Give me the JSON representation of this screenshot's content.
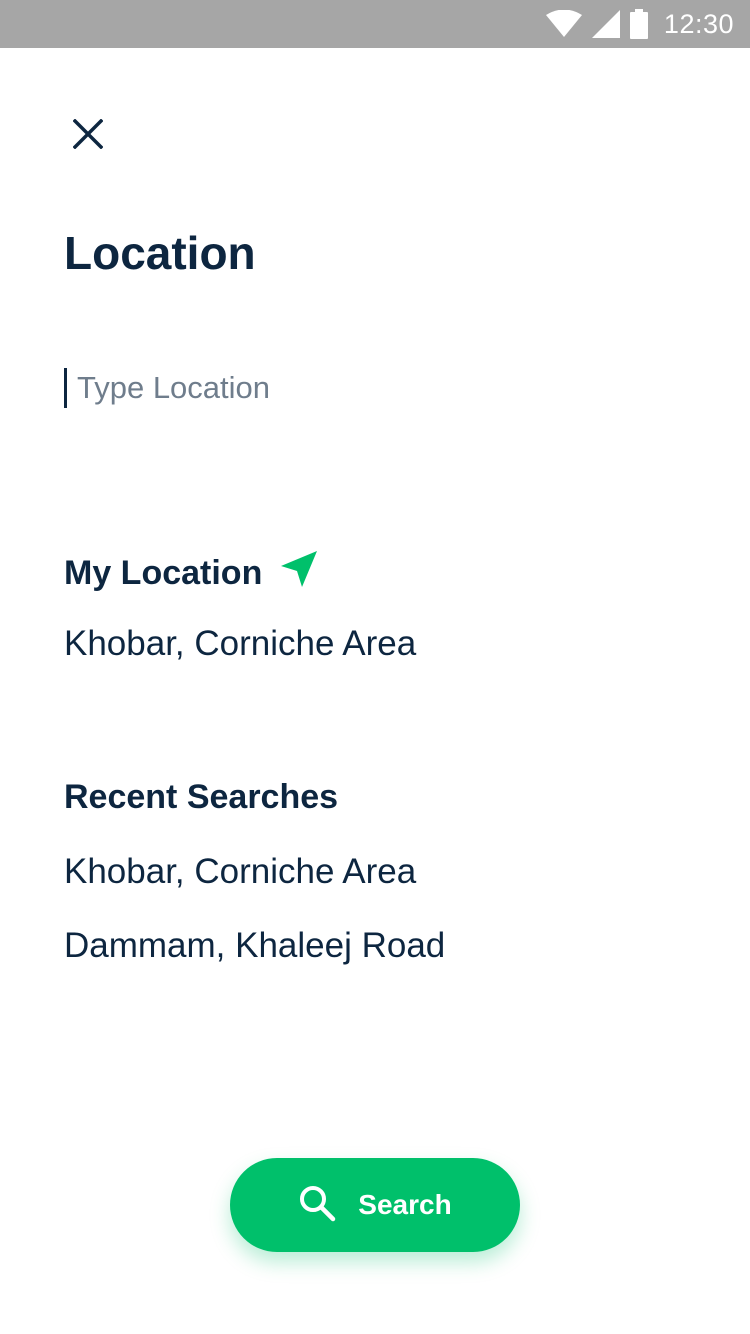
{
  "status_bar": {
    "time": "12:30",
    "icons": [
      "wifi-icon",
      "cell-signal-icon",
      "battery-icon"
    ]
  },
  "header": {
    "close_icon": "close-icon",
    "title": "Location"
  },
  "search": {
    "placeholder": "Type Location",
    "value": ""
  },
  "my_location": {
    "heading": "My Location",
    "icon": "navigation-arrow-icon",
    "value": "Khobar, Corniche Area"
  },
  "recent_searches": {
    "heading": "Recent Searches",
    "items": [
      "Khobar, Corniche Area",
      "Dammam, Khaleej Road"
    ]
  },
  "search_button": {
    "label": "Search",
    "icon": "search-icon"
  },
  "colors": {
    "accent": "#00c06b",
    "text": "#0d2640",
    "status_bar": "#a6a6a6",
    "placeholder": "#6f7d8c"
  }
}
